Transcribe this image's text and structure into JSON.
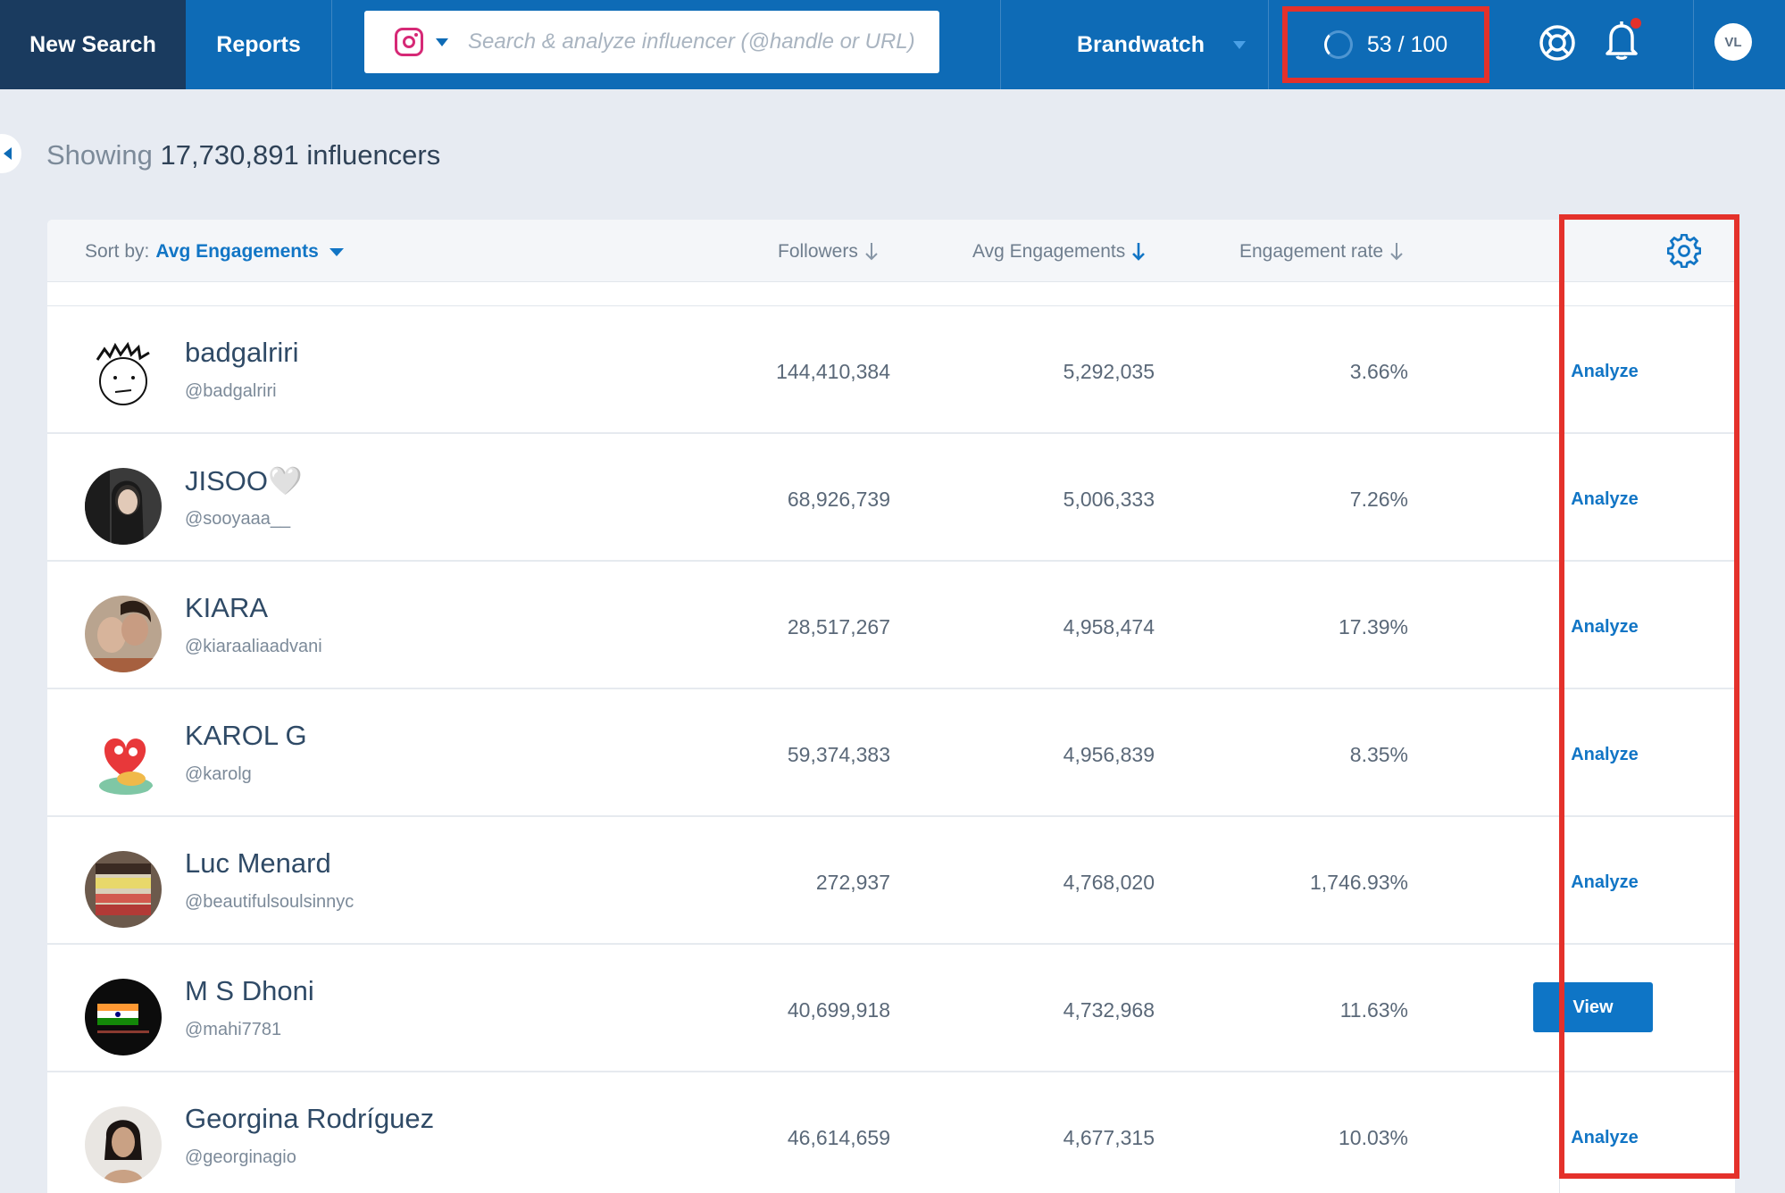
{
  "nav": {
    "new_search": "New Search",
    "reports": "Reports",
    "search_placeholder": "Search & analyze influencer (@handle or URL)",
    "platform_icon": "instagram-icon",
    "workspace": "Brandwatch",
    "credits": "53 / 100",
    "user_initials": "VL",
    "colors": {
      "bar": "#0e6bb6",
      "active_tab": "#1a3b5f",
      "highlight": "#e4312b"
    }
  },
  "summary": {
    "prefix": "Showing",
    "count": "17,730,891",
    "suffix": "influencers"
  },
  "table": {
    "sort_label": "Sort by:",
    "sort_value": "Avg Engagements",
    "columns": {
      "followers": "Followers",
      "avg_engagements": "Avg Engagements",
      "engagement_rate": "Engagement rate"
    },
    "rows": [
      {
        "name": "badgalriri",
        "handle": "@badgalriri",
        "followers": "144,410,384",
        "avg": "5,292,035",
        "rate": "3.66%",
        "action": "Analyze"
      },
      {
        "name": "JISOO🤍",
        "handle": "@sooyaaa__",
        "followers": "68,926,739",
        "avg": "5,006,333",
        "rate": "7.26%",
        "action": "Analyze"
      },
      {
        "name": "KIARA",
        "handle": "@kiaraaliaadvani",
        "followers": "28,517,267",
        "avg": "4,958,474",
        "rate": "17.39%",
        "action": "Analyze"
      },
      {
        "name": "KAROL G",
        "handle": "@karolg",
        "followers": "59,374,383",
        "avg": "4,956,839",
        "rate": "8.35%",
        "action": "Analyze"
      },
      {
        "name": "Luc Menard",
        "handle": "@beautifulsoulsinnyc",
        "followers": "272,937",
        "avg": "4,768,020",
        "rate": "1,746.93%",
        "action": "Analyze"
      },
      {
        "name": "M S Dhoni",
        "handle": "@mahi7781",
        "followers": "40,699,918",
        "avg": "4,732,968",
        "rate": "11.63%",
        "action": "View"
      },
      {
        "name": "Georgina Rodríguez",
        "handle": "@georginagio",
        "followers": "46,614,659",
        "avg": "4,677,315",
        "rate": "10.03%",
        "action": "Analyze"
      }
    ]
  }
}
